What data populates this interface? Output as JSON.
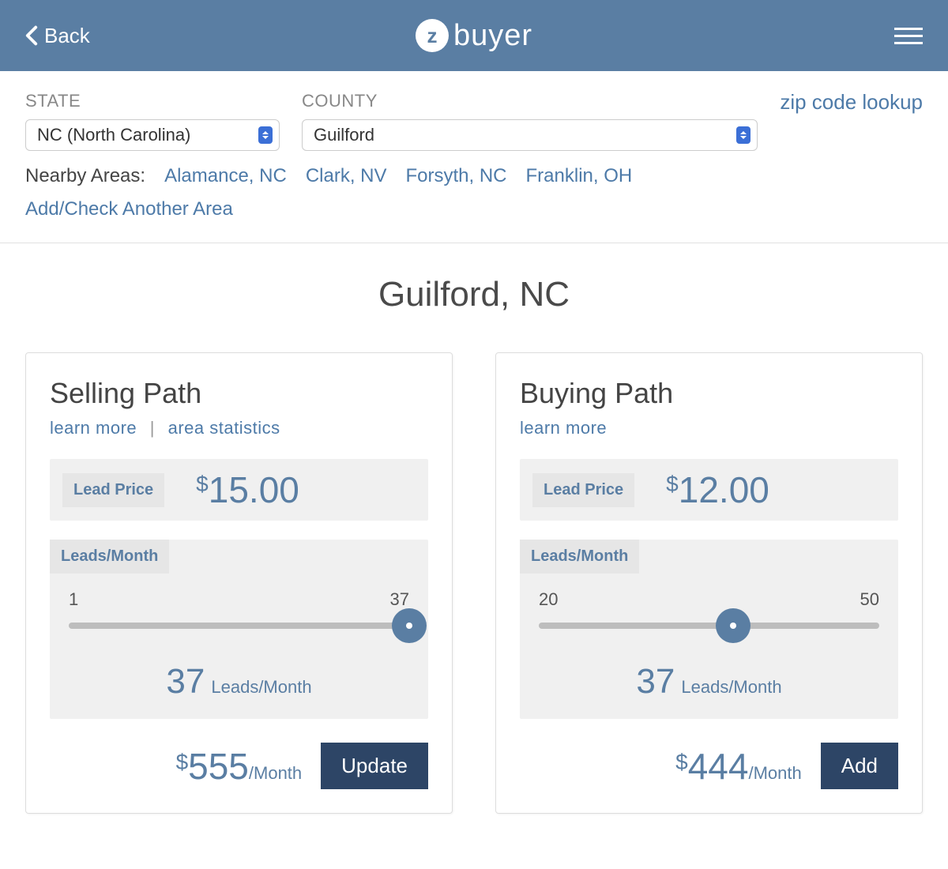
{
  "header": {
    "back_label": "Back",
    "brand_text": "buyer",
    "brand_mark": "z"
  },
  "filters": {
    "state_label": "STATE",
    "county_label": "COUNTY",
    "zip_lookup": "zip code lookup",
    "state_value": "NC (North Carolina)",
    "county_value": "Guilford",
    "nearby_label": "Nearby Areas:",
    "nearby": [
      "Alamance, NC",
      "Clark, NV",
      "Forsyth, NC",
      "Franklin, OH"
    ],
    "add_area": "Add/Check Another Area"
  },
  "page_title": "Guilford, NC",
  "cards": {
    "selling": {
      "title": "Selling Path",
      "learn_more": "learn more",
      "area_stats": "area statistics",
      "lead_price_label": "Lead Price",
      "lead_price": "15.00",
      "leads_label": "Leads/Month",
      "slider_min": "1",
      "slider_max": "37",
      "slider_pos_pct": 100,
      "leads_value": "37",
      "leads_unit": "Leads/Month",
      "total": "555",
      "per": "/Month",
      "action": "Update"
    },
    "buying": {
      "title": "Buying Path",
      "learn_more": "learn more",
      "lead_price_label": "Lead Price",
      "lead_price": "12.00",
      "leads_label": "Leads/Month",
      "slider_min": "20",
      "slider_max": "50",
      "slider_pos_pct": 57,
      "leads_value": "37",
      "leads_unit": "Leads/Month",
      "total": "444",
      "per": "/Month",
      "action": "Add"
    }
  }
}
